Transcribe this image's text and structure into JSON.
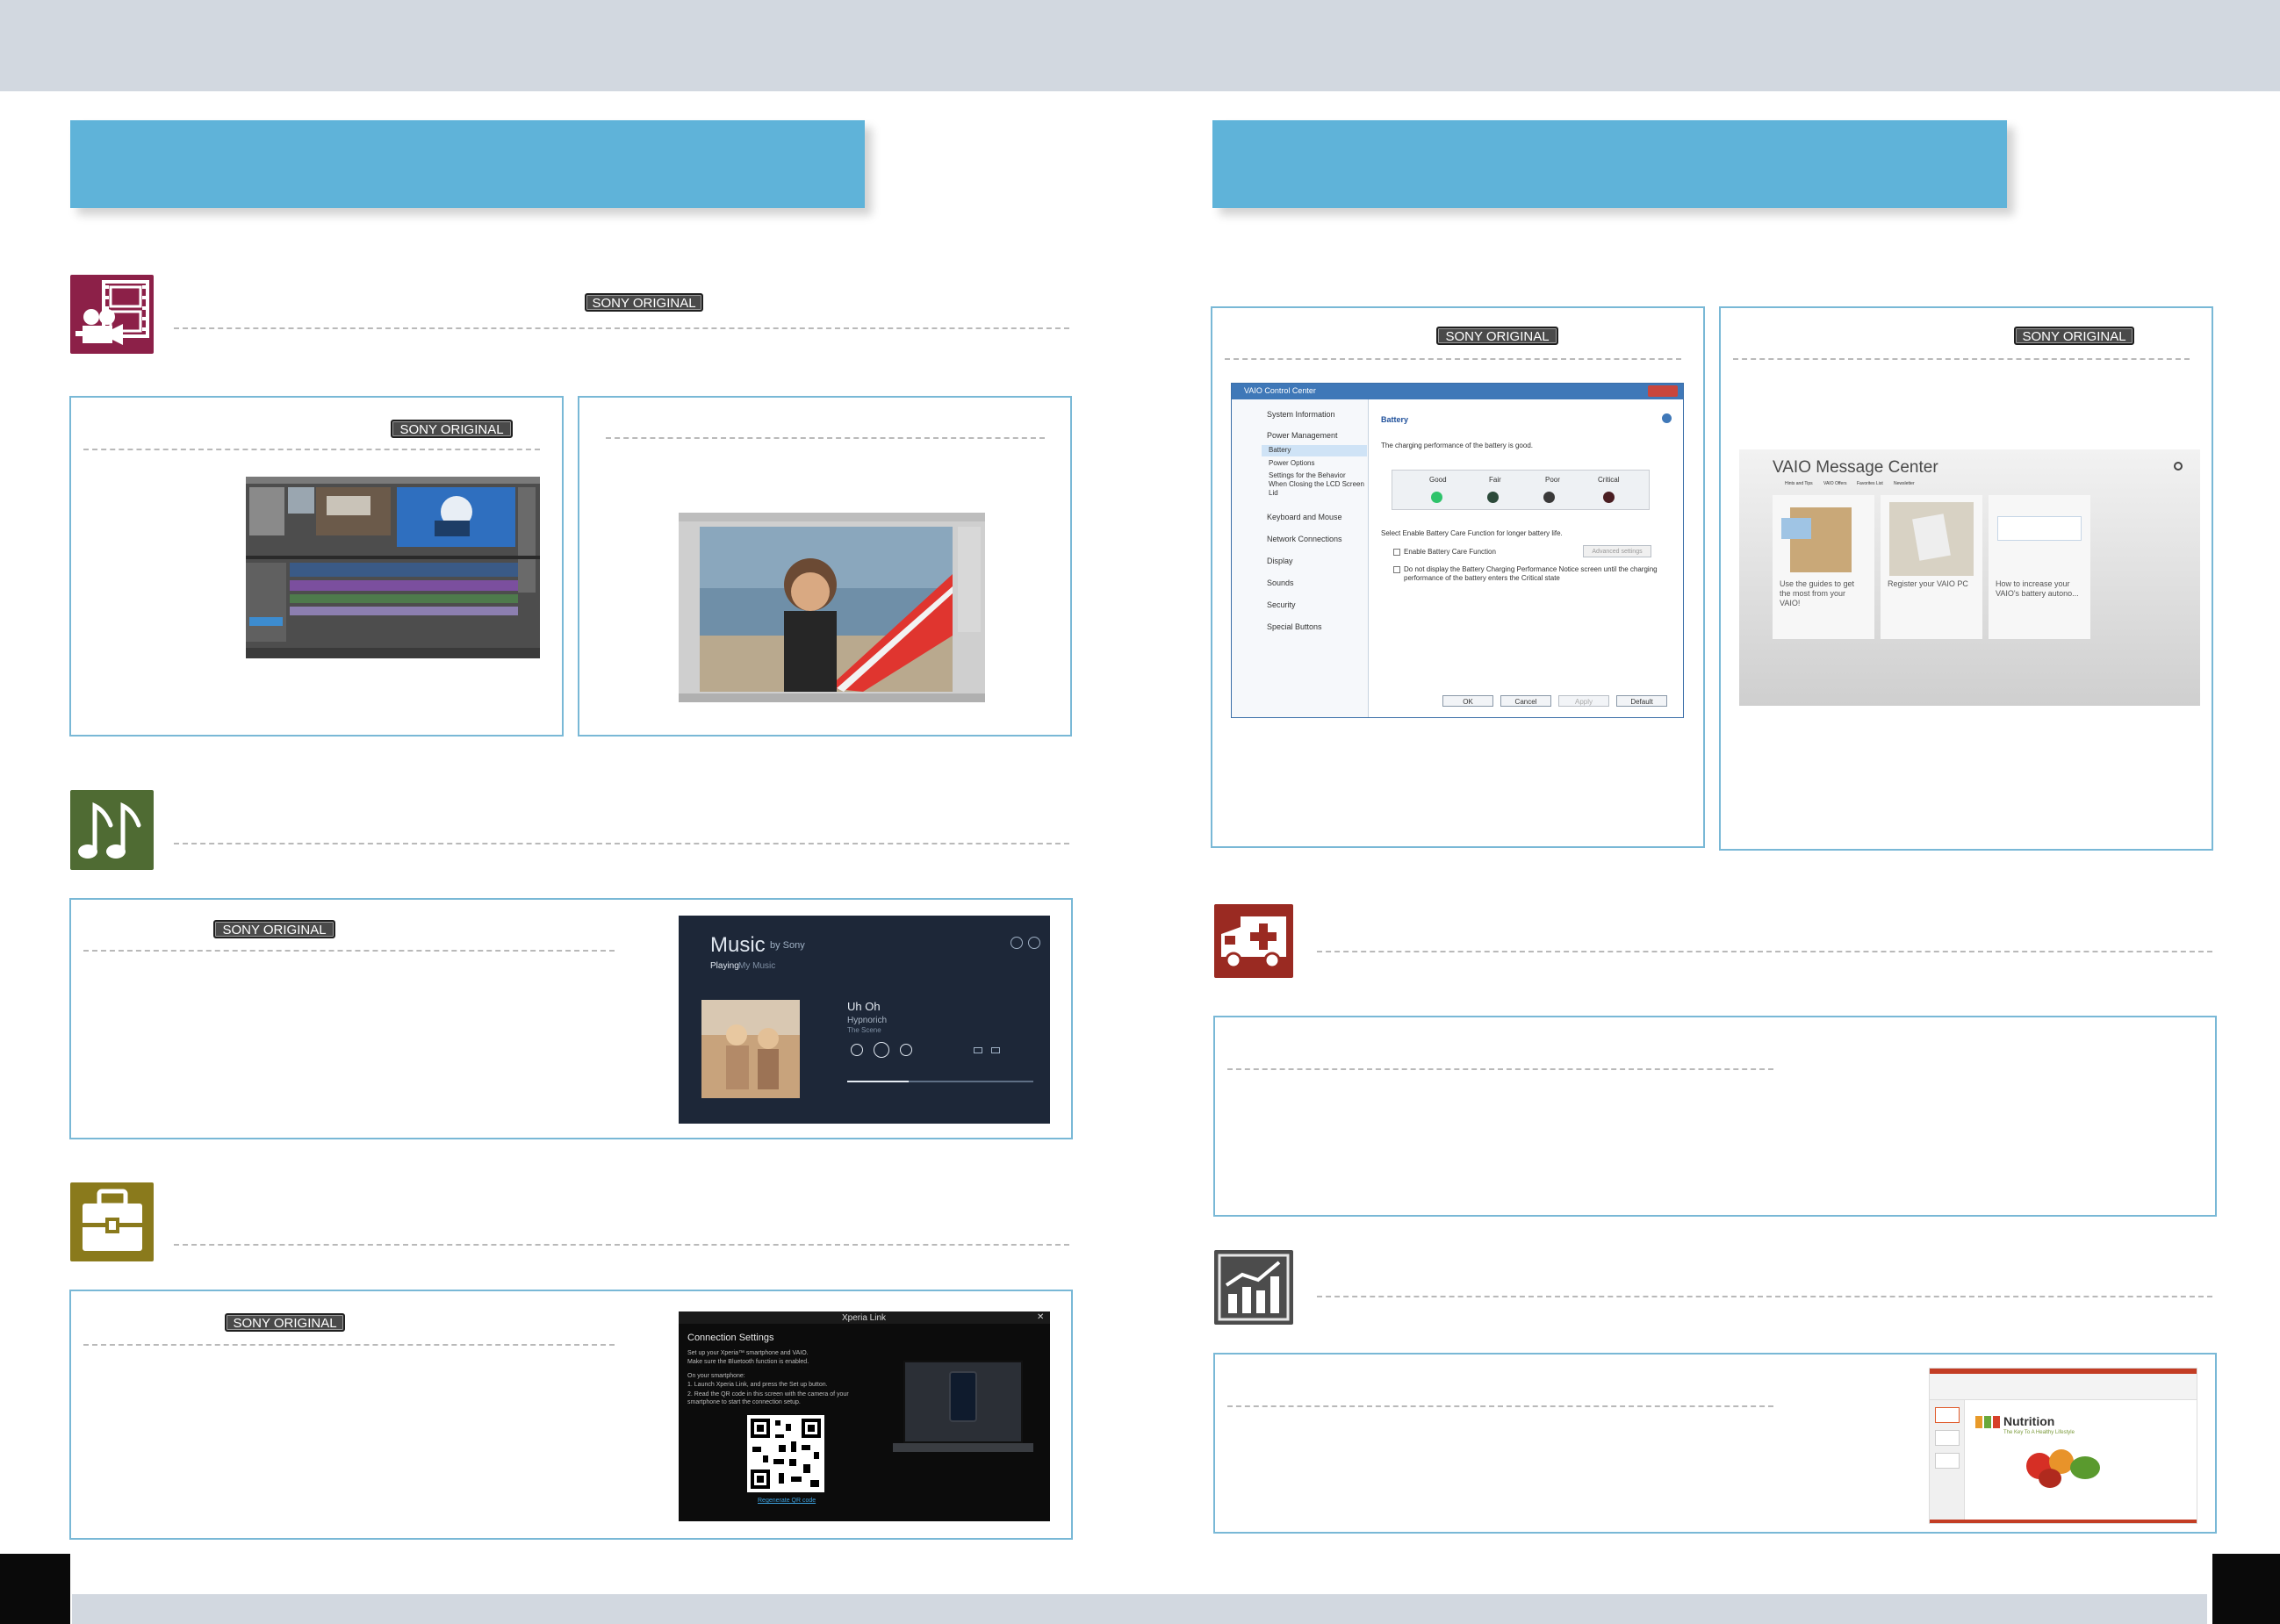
{
  "badges": {
    "video": "SONY ORIGINAL",
    "video_editor": "SONY ORIGINAL",
    "music": "SONY ORIGINAL",
    "xperia": "SONY ORIGINAL",
    "control_center": "SONY ORIGINAL",
    "message_center": "SONY ORIGINAL"
  },
  "vcc": {
    "window_title": "VAIO Control Center",
    "sidebar": [
      "System Information",
      "Power Management",
      "Battery",
      "Power Options",
      "Settings for the Behavior When Closing the LCD Screen Lid",
      "Keyboard and Mouse",
      "Network Connections",
      "Display",
      "Sounds",
      "Security",
      "Special Buttons"
    ],
    "heading": "Battery",
    "status": "The charging performance of the battery is good.",
    "levels": [
      "Good",
      "Fair",
      "Poor",
      "Critical"
    ],
    "care_prompt": "Select Enable Battery Care Function for longer battery life.",
    "enable_label": "Enable Battery Care Function",
    "advanced_btn": "Advanced settings",
    "notice_label": "Do not display the Battery Charging Performance Notice screen until the charging performance of the battery enters the Critical state",
    "buttons": [
      "OK",
      "Cancel",
      "Apply",
      "Default"
    ]
  },
  "vmc": {
    "title": "VAIO Message Center",
    "tabs": [
      "Hints and Tips",
      "VAIO Offers",
      "Favorites List",
      "Newsletter"
    ],
    "cards": [
      "Use the guides to get the most from your VAIO!",
      "Register your VAIO PC",
      "How to increase your VAIO's battery autono..."
    ]
  },
  "music_app": {
    "title": "Music",
    "by": "by Sony",
    "tabs": [
      "Playing",
      "My Music"
    ],
    "track": "Uh Oh",
    "artist": "Hypnorich",
    "album": "The Scene"
  },
  "xperia_app": {
    "title": "Xperia Link",
    "heading": "Connection Settings",
    "line1": "Set up your Xperia™ smartphone and VAIO.",
    "line2": "Make sure the Bluetooth function is enabled.",
    "line3": "On your smartphone:",
    "step1": "1. Launch Xperia Link, and press the Set up button.",
    "step2": "2. Read the QR code in this screen with the camera of your smartphone to start the connection setup.",
    "link": "Regenerate QR code"
  },
  "ppt_app": {
    "title": "Nutrition",
    "subtitle": "The Key To A Healthy Lifestyle"
  },
  "colors": {
    "banner": "#5fb3d9",
    "panel_border": "#79b8d6",
    "video_icon": "#8c2048",
    "music_icon": "#4f6b33",
    "tools_icon": "#8a7a1c",
    "care_icon": "#9a2a22",
    "office_icon": "#4c4c4c"
  },
  "icons": [
    "film-camera-icon",
    "music-notes-icon",
    "toolbox-icon",
    "ambulance-icon",
    "chart-icon"
  ]
}
